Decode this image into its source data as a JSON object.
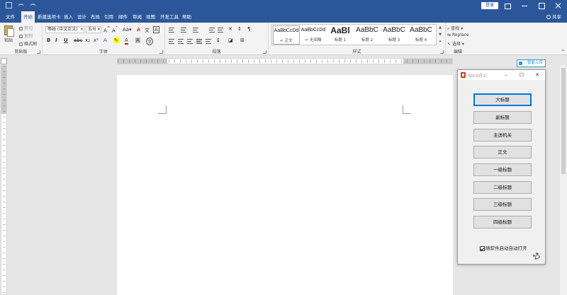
{
  "titlebar": {
    "login_label": "登录"
  },
  "tabs": [
    {
      "label": "文件"
    },
    {
      "label": "开始"
    },
    {
      "label": "新建选项卡"
    },
    {
      "label": "插入"
    },
    {
      "label": "设计"
    },
    {
      "label": "布局"
    },
    {
      "label": "引用"
    },
    {
      "label": "邮件"
    },
    {
      "label": "审阅"
    },
    {
      "label": "视图"
    },
    {
      "label": "开发工具"
    },
    {
      "label": "帮助"
    }
  ],
  "active_tab": "开始",
  "share_label": "共享",
  "ribbon": {
    "clipboard": {
      "paste_label": "粘贴",
      "cut_label": "剪切",
      "copy_label": "复制",
      "format_painter_label": "格式刷",
      "group_label": "剪贴板"
    },
    "font": {
      "font_name": "等线 (中文正文)",
      "font_size": "五号",
      "group_label": "字体"
    },
    "paragraph": {
      "group_label": "段落"
    },
    "styles": {
      "items": [
        {
          "preview": "AaBbCcDd",
          "name": "↵ 正文",
          "selected": true
        },
        {
          "preview": "AaBbCcDd",
          "name": "↵ 无间隔",
          "selected": false
        },
        {
          "preview": "AaBl",
          "name": "标题 1",
          "selected": false
        },
        {
          "preview": "AaBbC",
          "name": "标题 2",
          "selected": false
        },
        {
          "preview": "AaBbC",
          "name": "标题 3",
          "selected": false
        },
        {
          "preview": "AaBbC",
          "name": "标题 4",
          "selected": false
        }
      ],
      "group_label": "样式"
    },
    "editing": {
      "find_label": "查找",
      "replace_label": "Replace",
      "select_label": "选择",
      "group_label": "编辑"
    }
  },
  "ai_button_label": "智能上传",
  "panel": {
    "title": "Word办公",
    "buttons": [
      {
        "label": "大标题"
      },
      {
        "label": "副标题"
      },
      {
        "label": "主送机关"
      },
      {
        "label": "正文"
      },
      {
        "label": "一级标题"
      },
      {
        "label": "二级标题"
      },
      {
        "label": "三级标题"
      },
      {
        "label": "四级标题"
      }
    ],
    "checkbox_label": "随软件启动自动打开",
    "checkbox_checked": true
  },
  "colors": {
    "titlebar": "#2b579a",
    "ribbon": "#f3f3f3",
    "panel_focus": "#0078d7",
    "ai_button": "#2e9bd6"
  }
}
